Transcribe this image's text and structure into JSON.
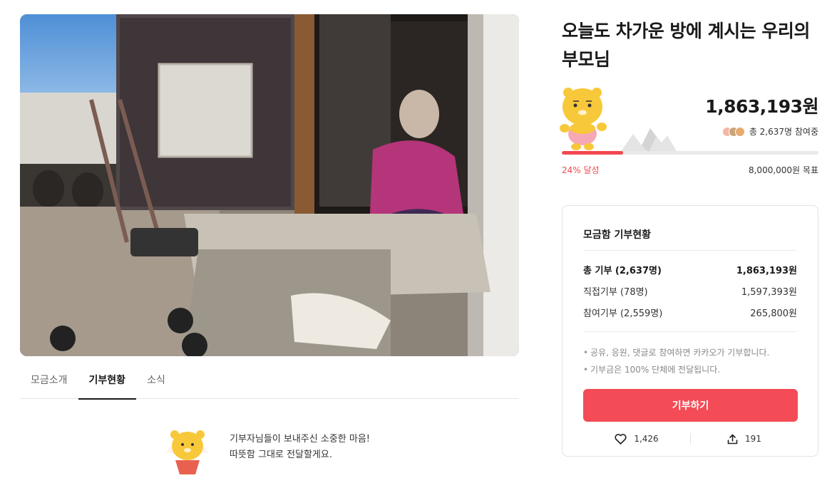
{
  "hero": {
    "image_alt": "photo-elderly-woman-in-room-doorway"
  },
  "tabs": [
    {
      "label": "모금소개",
      "active": false
    },
    {
      "label": "기부현황",
      "active": true
    },
    {
      "label": "소식",
      "active": false
    }
  ],
  "thanks": {
    "line1": "기부자님들이 보내주신 소중한 마음!",
    "line2": "따뜻함 그대로 전달할게요."
  },
  "campaign": {
    "title": "오늘도 차가운 방에 계시는 우리의 부모님",
    "amount": "1,863,193원",
    "participants": "총 2,637명 참여중",
    "progress_fraction": 0.24,
    "rate_label": "24% 달성",
    "goal_label": "8,000,000원 목표"
  },
  "card": {
    "title": "모금함 기부현황",
    "rows": [
      {
        "label": "총 기부 (2,637명)",
        "value": "1,863,193원"
      },
      {
        "label": "직접기부 (78명)",
        "value": "1,597,393원"
      },
      {
        "label": "참여기부 (2,559명)",
        "value": "265,800원"
      }
    ],
    "notes": [
      "공유, 응원, 댓글로 참여하면 카카오가 기부합니다.",
      "기부금은 100% 단체에 전달됩니다."
    ],
    "donate_label": "기부하기",
    "like_count": "1,426",
    "share_count": "191"
  },
  "colors": {
    "accent": "#f34c56",
    "mascot": "#f7c83a"
  },
  "icons": {
    "like": "heart-icon",
    "share": "share-icon"
  }
}
